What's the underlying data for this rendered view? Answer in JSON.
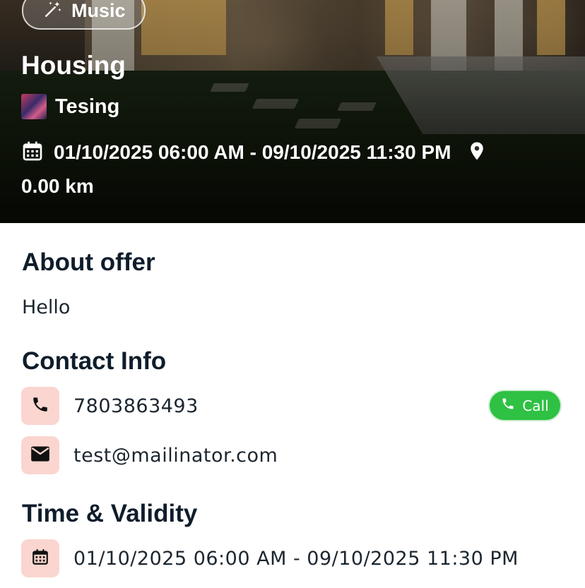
{
  "hero": {
    "category_chip": "Music",
    "title": "Housing",
    "organizer": "Tesing",
    "datetime_range": "01/10/2025 06:00 AM - 09/10/2025 11:30 PM",
    "distance": "0.00 km"
  },
  "about": {
    "heading": "About offer",
    "text": "Hello"
  },
  "contact": {
    "heading": "Contact Info",
    "phone": "7803863493",
    "call_label": "Call",
    "email": "test@mailinator.com"
  },
  "validity": {
    "heading": "Time & Validity",
    "datetime_range": "01/10/2025 06:00 AM - 09/10/2025 11:30 PM"
  },
  "colors": {
    "icon_bg": "#fbd5cf",
    "call_green": "#2ec143",
    "heading_text": "#0f1d2b"
  },
  "icons": [
    "magic-wand-icon",
    "calendar-icon",
    "location-pin-icon",
    "phone-icon",
    "mail-icon"
  ]
}
